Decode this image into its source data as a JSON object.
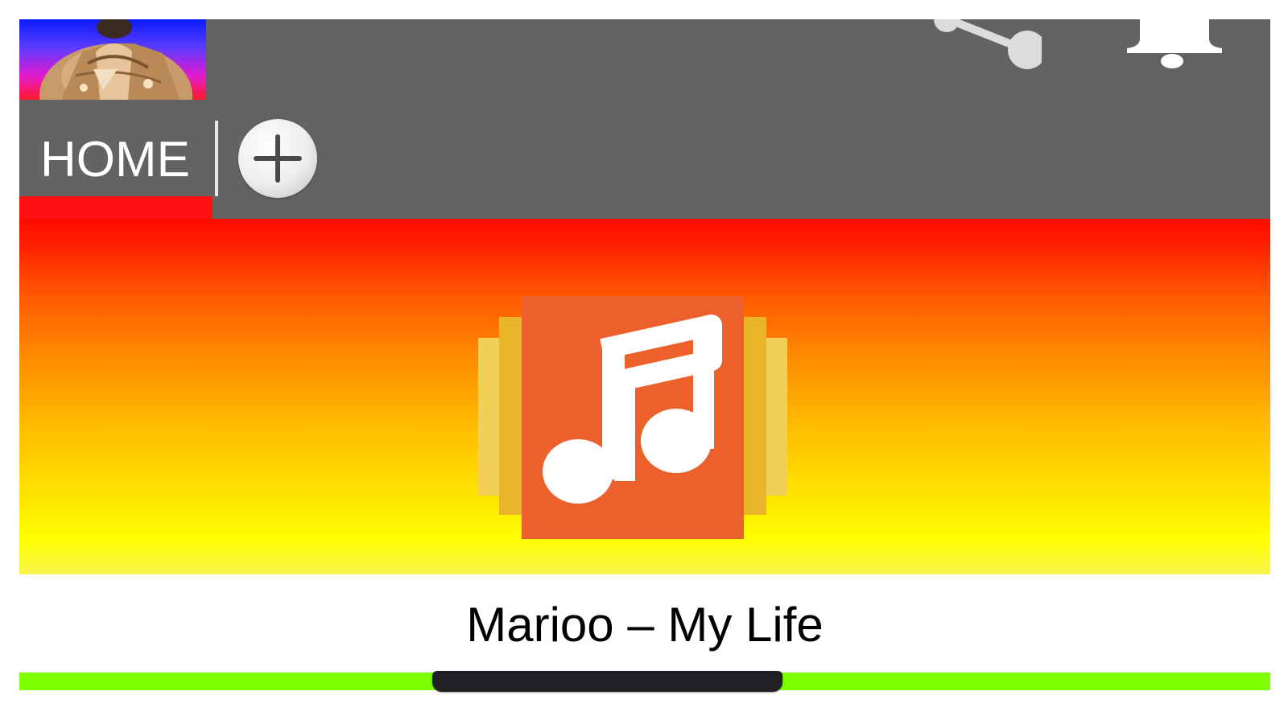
{
  "header": {
    "avatar": "artist-avatar",
    "share_icon": "share-icon",
    "bell_icon": "bell-icon"
  },
  "tabs": {
    "home_label": "HOME",
    "add_icon": "plus-icon"
  },
  "hero": {
    "art_icon": "music-note-icon"
  },
  "player": {
    "title": "Marioo – My Life",
    "progress": {
      "start": 0.33,
      "end": 0.61
    }
  },
  "colors": {
    "header_bg": "#636363",
    "progress_track": "#7dff00",
    "progress_thumb": "#1f2024",
    "art_front": "#ec612b",
    "art_mid": "#eab52a",
    "art_back": "#f2cf57",
    "hero_top": "#ff0b00",
    "hero_bottom": "#ffff00"
  }
}
